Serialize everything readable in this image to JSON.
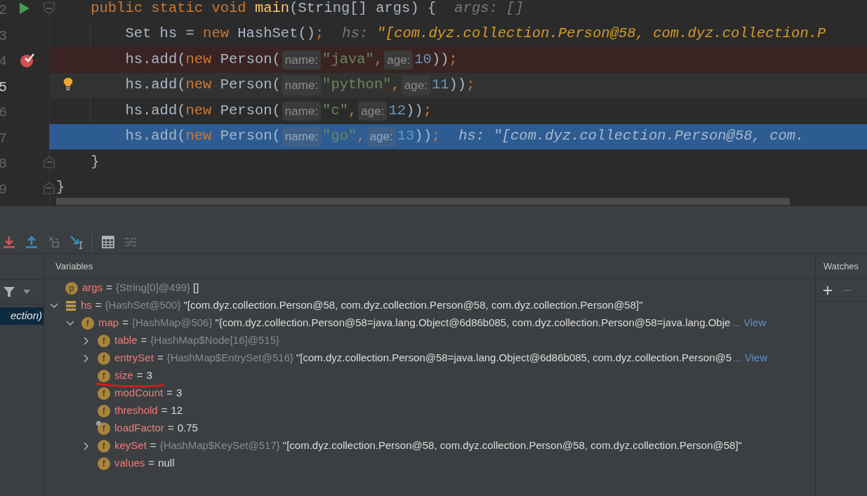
{
  "editor": {
    "lines": [
      {
        "children": [
          {
            "number": "2",
            "markers": [
              {
                "kind": "run"
              },
              {
                "kind": "fold_start"
              }
            ],
            "tokens": [
              {
                "kind": "keyword",
                "text": "public static void "
              },
              {
                "kind": "method",
                "text": "main"
              },
              {
                "kind": "plain",
                "text": "(String[] args) {"
              },
              {
                "kind": "inline_name",
                "text": "args: []"
              }
            ],
            "children": [
              {
                "number": "3",
                "tokens": [
                  {
                    "kind": "plain",
                    "text": "Set hs = "
                  },
                  {
                    "kind": "keyword",
                    "text": "new"
                  },
                  {
                    "kind": "plain",
                    "text": " HashSet()"
                  },
                  {
                    "kind": "punct",
                    "text": ";"
                  },
                  {
                    "kind": "inline_name",
                    "text": "hs: "
                  },
                  {
                    "kind": "inline_value",
                    "text": "\"[com.dyz.collection.Person@58, com.dyz.collection.P"
                  }
                ]
              },
              {
                "number": "4",
                "kind": "breakpoint",
                "markers": [
                  {
                    "kind": "breakpoint"
                  }
                ],
                "tokens": [
                  {
                    "kind": "plain",
                    "text": "hs.add("
                  },
                  {
                    "kind": "keyword",
                    "text": "new"
                  },
                  {
                    "kind": "plain",
                    "text": " Person("
                  },
                  {
                    "kind": "hint",
                    "text": "name:"
                  },
                  {
                    "kind": "string",
                    "text": "\"java\""
                  },
                  {
                    "kind": "punct",
                    "text": ","
                  },
                  {
                    "kind": "hint",
                    "text": "age:"
                  },
                  {
                    "kind": "number",
                    "text": "10"
                  },
                  {
                    "kind": "plain",
                    "text": "))"
                  },
                  {
                    "kind": "punct",
                    "text": ";"
                  }
                ]
              },
              {
                "number": "5",
                "kind": "caret",
                "markers": [
                  {
                    "kind": "bulb"
                  }
                ],
                "tokens": [
                  {
                    "kind": "plain",
                    "text": "hs.add("
                  },
                  {
                    "kind": "keyword",
                    "text": "new"
                  },
                  {
                    "kind": "plain",
                    "text": " Person("
                  },
                  {
                    "kind": "hint",
                    "text": "name:"
                  },
                  {
                    "kind": "string",
                    "text": "\"python\""
                  },
                  {
                    "kind": "punct",
                    "text": ","
                  },
                  {
                    "kind": "hint",
                    "text": "age:"
                  },
                  {
                    "kind": "number",
                    "text": "11"
                  },
                  {
                    "kind": "plain",
                    "text": "))"
                  },
                  {
                    "kind": "punct",
                    "text": ";"
                  }
                ]
              },
              {
                "number": "6",
                "tokens": [
                  {
                    "kind": "plain",
                    "text": "hs.add("
                  },
                  {
                    "kind": "keyword",
                    "text": "new"
                  },
                  {
                    "kind": "plain",
                    "text": " Person("
                  },
                  {
                    "kind": "hint",
                    "text": "name:"
                  },
                  {
                    "kind": "string",
                    "text": "\"c\""
                  },
                  {
                    "kind": "punct",
                    "text": ","
                  },
                  {
                    "kind": "hint",
                    "text": "age:"
                  },
                  {
                    "kind": "number",
                    "text": "12"
                  },
                  {
                    "kind": "plain",
                    "text": "))"
                  },
                  {
                    "kind": "punct",
                    "text": ";"
                  }
                ]
              },
              {
                "number": "7",
                "kind": "execution",
                "tokens": [
                  {
                    "kind": "plain",
                    "text": "hs.add("
                  },
                  {
                    "kind": "keyword",
                    "text": "new"
                  },
                  {
                    "kind": "plain",
                    "text": " Person("
                  },
                  {
                    "kind": "hint",
                    "text": "name:"
                  },
                  {
                    "kind": "string",
                    "text": "\"go\""
                  },
                  {
                    "kind": "punct",
                    "text": ","
                  },
                  {
                    "kind": "hint",
                    "text": "age:"
                  },
                  {
                    "kind": "number",
                    "text": "13"
                  },
                  {
                    "kind": "plain",
                    "text": "))"
                  },
                  {
                    "kind": "punct",
                    "text": ";"
                  },
                  {
                    "kind": "inline_name",
                    "text": "hs: "
                  },
                  {
                    "kind": "inline_value",
                    "text": "\"[com.dyz.collection.Person@58, com."
                  }
                ]
              }
            ]
          },
          {
            "number": "8",
            "markers": [
              {
                "kind": "fold_end"
              }
            ],
            "tokens": [
              {
                "kind": "plain",
                "text": "}"
              }
            ]
          }
        ]
      },
      {
        "number": "9",
        "markers": [
          {
            "kind": "fold_end"
          }
        ],
        "tokens": [
          {
            "kind": "plain",
            "text": "}"
          }
        ]
      }
    ]
  },
  "toolbar": [
    {
      "kind": "step_into",
      "disabled": false
    },
    {
      "kind": "step_out",
      "disabled": false
    },
    {
      "kind": "drop_frame",
      "disabled": true
    },
    {
      "kind": "run_to_cursor",
      "disabled": false
    },
    {
      "kind": "separator",
      "disabled": false
    },
    {
      "kind": "evaluate",
      "disabled": false
    },
    {
      "kind": "trace",
      "disabled": true
    }
  ],
  "frames": [
    {
      "text": "ection)",
      "selected": true
    }
  ],
  "variables_title": "Variables",
  "variables": [
    {
      "kind": "parameter",
      "letter": "p",
      "name": "args",
      "op": "=",
      "type": "{String[0]@499}",
      "value": "[]",
      "underlined": false
    },
    {
      "kind": "set",
      "name": "hs",
      "op": "=",
      "type": "{HashSet@500}",
      "value": "\"[com.dyz.collection.Person@58, com.dyz.collection.Person@58, com.dyz.collection.Person@58]\"",
      "underlined": false,
      "expanded": true,
      "children": [
        {
          "kind": "field",
          "letter": "f",
          "name": "map",
          "op": "=",
          "type": "{HashMap@506}",
          "value": "\"{com.dyz.collection.Person@58=java.lang.Object@6d86b085, com.dyz.collection.Person@58=java.lang.Obje",
          "link": "... View",
          "underlined": false,
          "expanded": true,
          "children": [
            {
              "kind": "field",
              "letter": "f",
              "name": "table",
              "op": "=",
              "type": "{HashMap$Node[16]@515}",
              "underlined": false,
              "expanded": false
            },
            {
              "kind": "field",
              "letter": "f",
              "name": "entrySet",
              "op": "=",
              "type": "{HashMap$EntrySet@516}",
              "value": "\"[com.dyz.collection.Person@58=java.lang.Object@6d86b085, com.dyz.collection.Person@5",
              "link": "... View",
              "underlined": false,
              "expanded": false
            },
            {
              "kind": "field",
              "letter": "f",
              "name": "size",
              "op": "=",
              "value": "3",
              "underlined": true
            },
            {
              "kind": "field",
              "letter": "f",
              "name": "modCount",
              "op": "=",
              "value": "3",
              "underlined": false
            },
            {
              "kind": "field",
              "letter": "f",
              "name": "threshold",
              "op": "=",
              "value": "12",
              "underlined": false
            },
            {
              "kind": "final_field",
              "letter": "f",
              "name": "loadFactor",
              "op": "=",
              "value": "0.75",
              "underlined": false
            },
            {
              "kind": "field",
              "letter": "f",
              "name": "keySet",
              "op": "=",
              "type": "{HashMap$KeySet@517}",
              "value": "\"[com.dyz.collection.Person@58, com.dyz.collection.Person@58, com.dyz.collection.Person@58]\"",
              "underlined": false,
              "expanded": false
            },
            {
              "kind": "field",
              "letter": "f",
              "name": "values",
              "op": "=",
              "value": "null",
              "underlined": false
            }
          ]
        }
      ]
    }
  ],
  "watches_title": "Watches",
  "watch_buttons": [
    {
      "kind": "add",
      "disabled": false
    },
    {
      "kind": "remove",
      "disabled": true
    }
  ]
}
